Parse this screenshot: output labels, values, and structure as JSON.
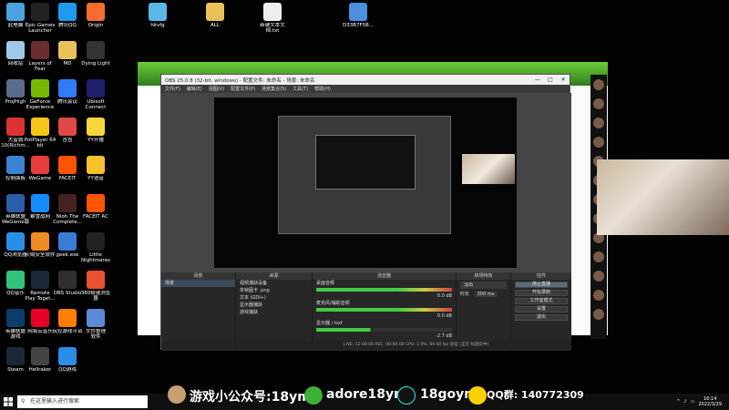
{
  "desktop_icons": [
    {
      "label": "此电脑",
      "color": "#4aa3df"
    },
    {
      "label": "Epic Games\nLauncher",
      "color": "#222222"
    },
    {
      "label": "腾讯QQ",
      "color": "#1e9bf0"
    },
    {
      "label": "Origin",
      "color": "#f56c2d"
    },
    {
      "label": "回收站",
      "color": "#9ec9e8"
    },
    {
      "label": "Layers of\nFear",
      "color": "#6b2e2e"
    },
    {
      "label": "MD",
      "color": "#e8c15a"
    },
    {
      "label": "Dying Light",
      "color": "#333333"
    },
    {
      "label": "ProjHigh",
      "color": "#5b6b8b"
    },
    {
      "label": "GeForce\nExperience",
      "color": "#76b900"
    },
    {
      "label": "腾讯会议",
      "color": "#2f7cf6"
    },
    {
      "label": "Ubisoft\nConnect",
      "color": "#1f1f6b"
    },
    {
      "label": "大富翁\n10(Richm...",
      "color": "#d33"
    },
    {
      "label": "PotPlayer 64\nbit",
      "color": "#f5c518"
    },
    {
      "label": "吉吉",
      "color": "#e04848"
    },
    {
      "label": "YY开播",
      "color": "#f7d53a"
    },
    {
      "label": "控制面板",
      "color": "#3a82d2"
    },
    {
      "label": "WeGame",
      "color": "#e83d3d"
    },
    {
      "label": "FACEIT",
      "color": "#ff5500"
    },
    {
      "label": "YY语音",
      "color": "#f7c12e"
    },
    {
      "label": "英雄联盟\nWeGame版",
      "color": "#2a5ea8"
    },
    {
      "label": "暴雪战网",
      "color": "#148eff"
    },
    {
      "label": "Nioh The\nComplete...",
      "color": "#442222"
    },
    {
      "label": "FACEIT AC",
      "color": "#ff5500"
    },
    {
      "label": "QQ浏览器",
      "color": "#2a8ee8"
    },
    {
      "label": "火绒安全软件",
      "color": "#f08a24"
    },
    {
      "label": "geek.exe",
      "color": "#3a7bd5"
    },
    {
      "label": "Little\nNightmares",
      "color": "#222222"
    },
    {
      "label": "QQ音乐",
      "color": "#31c27c"
    },
    {
      "label": "Remote\nPlay Toget...",
      "color": "#1b2838"
    },
    {
      "label": "OBS Studio",
      "color": "#302e31"
    },
    {
      "label": "360极速浏览\n器",
      "color": "#e8522c"
    },
    {
      "label": "英雄联盟\n游戏",
      "color": "#0a3d6b"
    },
    {
      "label": "网易云音乐",
      "color": "#e60026"
    },
    {
      "label": "玩控游戏平台",
      "color": "#ff7d00"
    },
    {
      "label": "文件整理\n软件",
      "color": "#5a8bd6"
    },
    {
      "label": "Steam",
      "color": "#1b2838"
    },
    {
      "label": "Hellraker",
      "color": "#444444"
    },
    {
      "label": "QQ游戏",
      "color": "#2a8ee8"
    },
    {
      "label": "hkvfg",
      "color": "#5bb8e8"
    },
    {
      "label": "ALL",
      "color": "#e8c15a"
    },
    {
      "label": "新建文本文\n档.txt",
      "color": "#eeeeee"
    },
    {
      "label": "D33B7F08...",
      "color": "#4a8fe0"
    }
  ],
  "obs": {
    "title": "OBS 25.0.8 (32-bit, windows) - 配置文件: 未命名 - 场景: 未命名",
    "menu": [
      "文件(F)",
      "编辑(E)",
      "视图(V)",
      "配置文件(P)",
      "场景集合(S)",
      "工具(T)",
      "帮助(H)"
    ],
    "docks": {
      "scenes_title": "场景",
      "scene_item": "场景",
      "sources_title": "来源",
      "sources": [
        "视频捕获设备",
        "单帧图卡 .png",
        "文本 (GDI+)",
        "显示器捕获",
        "游戏捕获"
      ],
      "mixer_title": "混音器",
      "mixer": [
        {
          "name": "桌面音频",
          "db": "0.0 dB"
        },
        {
          "name": "麦克风/辅助音频",
          "db": "0.0 dB"
        },
        {
          "name": "显示器 / lsxf",
          "db": "-2.7 dB"
        }
      ],
      "transitions_title": "转场特效",
      "transition_value": "淡出",
      "duration_label": "时长",
      "duration_value": "300 ms",
      "controls_title": "控件",
      "controls": [
        "停止直播",
        "开始录制",
        "工作室模式",
        "设置",
        "退出"
      ]
    },
    "status": "LIVE: 12:00:00   REC: 00:00:00   CPU: 1.0%, 60.00 fps    验证 (正在 标题页中)"
  },
  "taskbar": {
    "search_placeholder": "在这里输入进行搜索",
    "time": "16:14",
    "date": "2022/3/29"
  },
  "overlay": {
    "gzh": "游戏小公众号:18ym",
    "wechat": "adore18ym",
    "tiktok": "18goym",
    "qq": "QQ群: 140772309"
  }
}
